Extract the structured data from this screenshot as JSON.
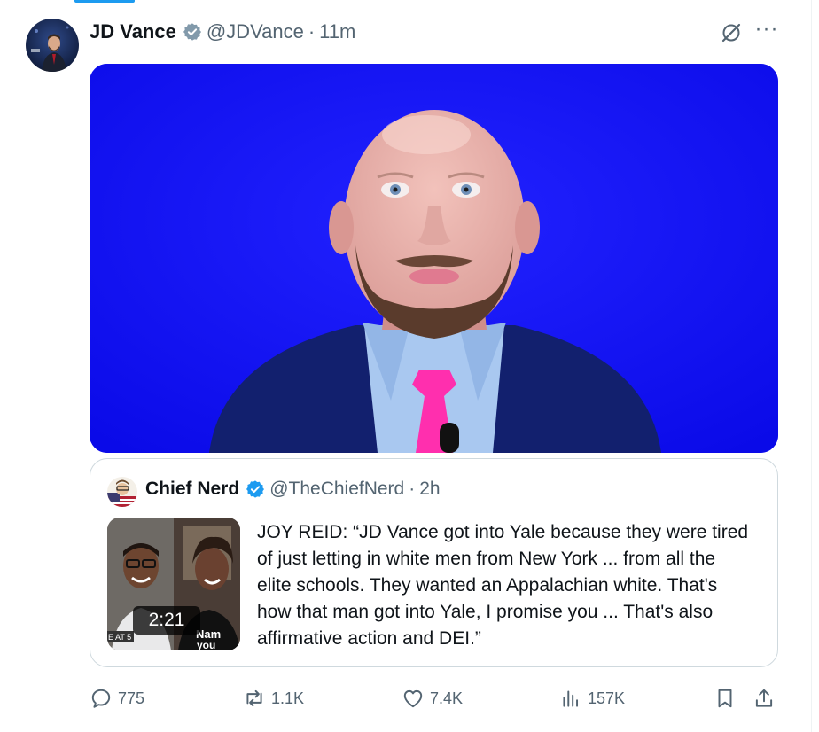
{
  "tweet": {
    "author": {
      "display_name": "JD Vance",
      "handle": "@JDVance",
      "verified_icon": "verified-badge-gray"
    },
    "separator": "·",
    "time": "11m",
    "more_label": "···",
    "media": {
      "icon": "image"
    }
  },
  "quote": {
    "author": {
      "display_name": "Chief Nerd",
      "handle": "@TheChiefNerd",
      "verified_icon": "verified-badge-blue"
    },
    "separator": "·",
    "time": "2h",
    "video_duration": "2:21",
    "text": "JOY REID: “JD Vance got into Yale because they were tired of just letting in white men from New York ... from all the elite schools. They wanted an Appalachian white. That's how that man got into Yale, I promise you ... That's also affirmative action and DEI.”"
  },
  "actions": {
    "replies": "775",
    "reposts": "1.1K",
    "likes": "7.4K",
    "views": "157K"
  },
  "colors": {
    "accent": "#1d9bf0",
    "secondary_text": "#536471",
    "primary_text": "#0f1419",
    "border": "#cfd9de"
  }
}
